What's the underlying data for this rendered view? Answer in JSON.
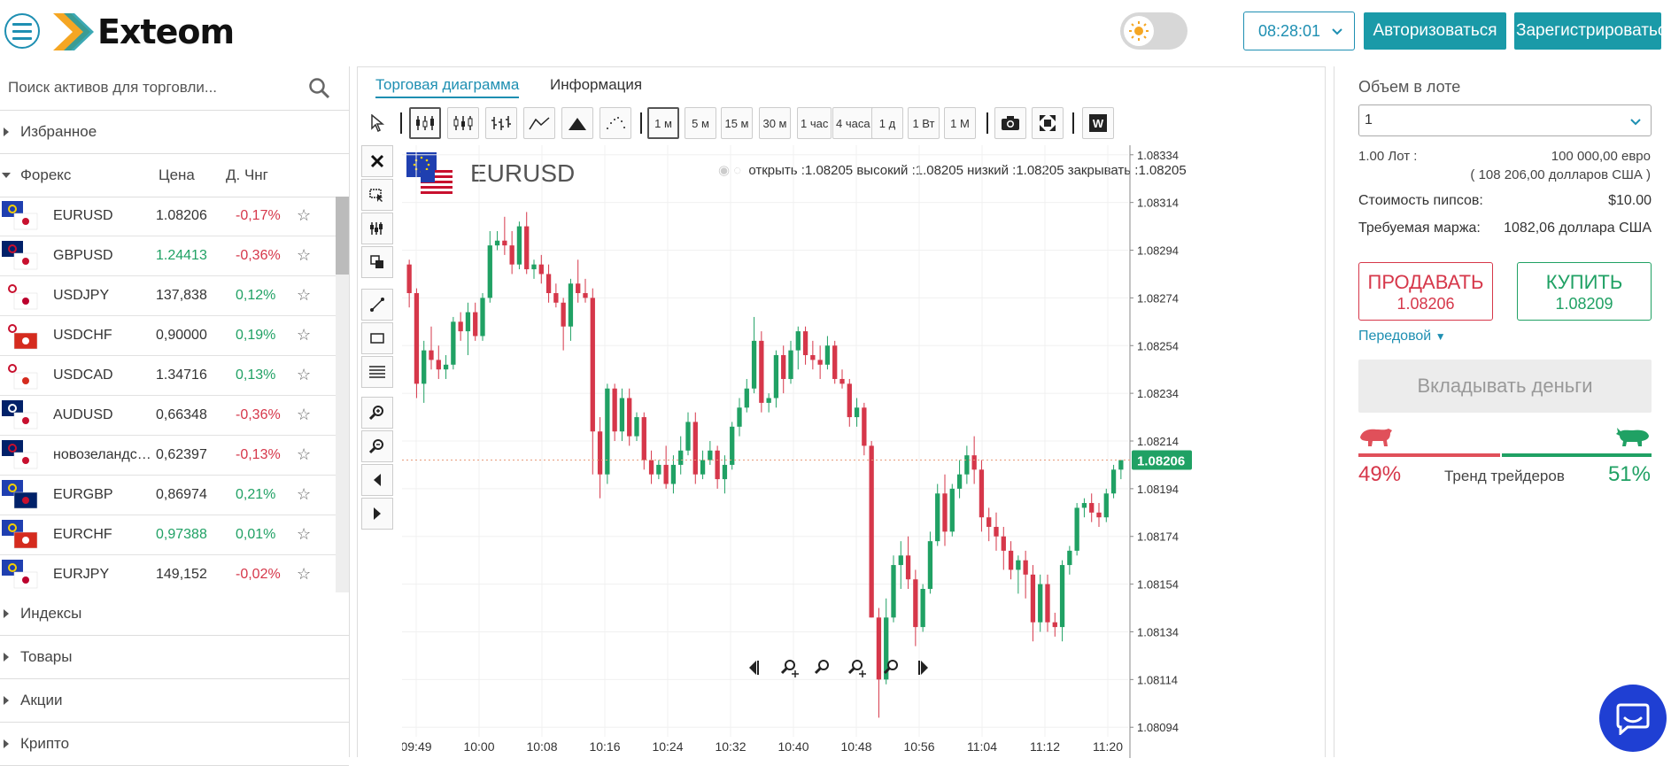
{
  "header": {
    "brand": "Exteom",
    "time": "08:28:01",
    "login_label": "Авторизоваться",
    "register_label": "Зарегистрироваться"
  },
  "sidebar": {
    "search_placeholder": "Поиск активов для торговли...",
    "favorites_label": "Избранное",
    "forex_label": "Форекс",
    "price_col": "Цена",
    "change_col": "Д. Чнг",
    "assets": [
      {
        "name": "EURUSD",
        "price": "1.08206",
        "change": "-0,17%",
        "price_dir": "neutral",
        "change_dir": "dn"
      },
      {
        "name": "GBPUSD",
        "price": "1.24413",
        "change": "-0,36%",
        "price_dir": "up",
        "change_dir": "dn"
      },
      {
        "name": "USDJPY",
        "price": "137,838",
        "change": "0,12%",
        "price_dir": "neutral",
        "change_dir": "up"
      },
      {
        "name": "USDCHF",
        "price": "0,90000",
        "change": "0,19%",
        "price_dir": "neutral",
        "change_dir": "up"
      },
      {
        "name": "USDCAD",
        "price": "1.34716",
        "change": "0,13%",
        "price_dir": "neutral",
        "change_dir": "up"
      },
      {
        "name": "AUDUSD",
        "price": "0,66348",
        "change": "-0,36%",
        "price_dir": "neutral",
        "change_dir": "dn"
      },
      {
        "name": "новозеландский доллар",
        "price": "0,62397",
        "change": "-0,13%",
        "price_dir": "neutral",
        "change_dir": "dn"
      },
      {
        "name": "EURGBP",
        "price": "0,86974",
        "change": "0,21%",
        "price_dir": "neutral",
        "change_dir": "up"
      },
      {
        "name": "EURCHF",
        "price": "0,97388",
        "change": "0,01%",
        "price_dir": "up",
        "change_dir": "up"
      },
      {
        "name": "EURJPY",
        "price": "149,152",
        "change": "-0,02%",
        "price_dir": "neutral",
        "change_dir": "dn"
      }
    ],
    "categories_below": [
      "Индексы",
      "Товары",
      "Акции",
      "Крипто"
    ]
  },
  "chart_panel": {
    "tabs": [
      "Торговая диаграмма",
      "Информация"
    ],
    "timeframes": [
      "1 м",
      "5 м",
      "15 м",
      "30 м",
      "1 час",
      "4 часа",
      "1 д",
      "1 Вт",
      "1 М"
    ],
    "symbol": "EURUSD",
    "ohlc_text": "открыть :1.08205 высокий :1.08205 низкий :1.08205 закрывать :1.08205",
    "current_price": "1.08206"
  },
  "chart_data": {
    "type": "candlestick",
    "y_ticks": [
      "1.08334",
      "1.08314",
      "1.08294",
      "1.08274",
      "1.08254",
      "1.08234",
      "1.08214",
      "1.08194",
      "1.08174",
      "1.08154",
      "1.08134",
      "1.08114",
      "1.08094"
    ],
    "x_ticks": [
      "09:49",
      "10:00",
      "10:08",
      "10:16",
      "10:24",
      "10:32",
      "10:40",
      "10:48",
      "10:56",
      "11:04",
      "11:12",
      "11:20"
    ],
    "ylim": [
      1.0809,
      1.08338
    ],
    "current_price": 1.08206,
    "candles": [
      [
        1.08288,
        1.0829,
        1.0827,
        1.08276
      ],
      [
        1.08276,
        1.08278,
        1.08232,
        1.08238
      ],
      [
        1.08238,
        1.08256,
        1.0823,
        1.08252
      ],
      [
        1.08252,
        1.08262,
        1.08244,
        1.08248
      ],
      [
        1.08248,
        1.08254,
        1.0824,
        1.08244
      ],
      [
        1.08244,
        1.0825,
        1.0824,
        1.08246
      ],
      [
        1.08246,
        1.08266,
        1.08244,
        1.08264
      ],
      [
        1.08264,
        1.08268,
        1.08256,
        1.0826
      ],
      [
        1.0826,
        1.08272,
        1.0825,
        1.08268
      ],
      [
        1.08268,
        1.08272,
        1.08256,
        1.08258
      ],
      [
        1.08258,
        1.08276,
        1.08256,
        1.08274
      ],
      [
        1.08274,
        1.08302,
        1.08272,
        1.08296
      ],
      [
        1.08296,
        1.08302,
        1.08294,
        1.08298
      ],
      [
        1.08298,
        1.08308,
        1.08292,
        1.08296
      ],
      [
        1.08296,
        1.08302,
        1.08284,
        1.08288
      ],
      [
        1.08288,
        1.08306,
        1.08286,
        1.08304
      ],
      [
        1.08304,
        1.0831,
        1.08284,
        1.08286
      ],
      [
        1.08286,
        1.0829,
        1.08282,
        1.08288
      ],
      [
        1.08288,
        1.08292,
        1.0828,
        1.08284
      ],
      [
        1.08284,
        1.08288,
        1.08272,
        1.08276
      ],
      [
        1.08276,
        1.0828,
        1.0827,
        1.08272
      ],
      [
        1.08272,
        1.08274,
        1.08252,
        1.08262
      ],
      [
        1.08262,
        1.08282,
        1.08256,
        1.0828
      ],
      [
        1.0828,
        1.0829,
        1.08272,
        1.08276
      ],
      [
        1.08276,
        1.08282,
        1.08272,
        1.08274
      ],
      [
        1.08274,
        1.08278,
        1.082,
        1.08218
      ],
      [
        1.08218,
        1.08224,
        1.0819,
        1.082
      ],
      [
        1.082,
        1.08238,
        1.08196,
        1.08236
      ],
      [
        1.08236,
        1.08238,
        1.08214,
        1.08218
      ],
      [
        1.08218,
        1.08236,
        1.08214,
        1.08232
      ],
      [
        1.08232,
        1.08236,
        1.08212,
        1.08216
      ],
      [
        1.08216,
        1.08226,
        1.08214,
        1.08224
      ],
      [
        1.08224,
        1.08226,
        1.08202,
        1.08206
      ],
      [
        1.08206,
        1.0821,
        1.08196,
        1.082
      ],
      [
        1.082,
        1.08206,
        1.08198,
        1.08204
      ],
      [
        1.08204,
        1.08212,
        1.08194,
        1.08196
      ],
      [
        1.08196,
        1.08208,
        1.08192,
        1.08204
      ],
      [
        1.08204,
        1.08216,
        1.082,
        1.0821
      ],
      [
        1.0821,
        1.08226,
        1.08208,
        1.08222
      ],
      [
        1.08222,
        1.08226,
        1.08196,
        1.082
      ],
      [
        1.082,
        1.0821,
        1.08198,
        1.08206
      ],
      [
        1.08206,
        1.08214,
        1.08204,
        1.0821
      ],
      [
        1.0821,
        1.08212,
        1.08194,
        1.08198
      ],
      [
        1.08198,
        1.08208,
        1.08192,
        1.08204
      ],
      [
        1.08204,
        1.08222,
        1.08202,
        1.0822
      ],
      [
        1.0822,
        1.08232,
        1.08216,
        1.08228
      ],
      [
        1.08228,
        1.0824,
        1.08226,
        1.08236
      ],
      [
        1.08236,
        1.08266,
        1.08234,
        1.08256
      ],
      [
        1.08256,
        1.0826,
        1.08226,
        1.0823
      ],
      [
        1.0823,
        1.08234,
        1.08226,
        1.08232
      ],
      [
        1.08232,
        1.08252,
        1.08228,
        1.0825
      ],
      [
        1.0825,
        1.08254,
        1.08234,
        1.0824
      ],
      [
        1.0824,
        1.08256,
        1.08238,
        1.08252
      ],
      [
        1.08252,
        1.08262,
        1.08244,
        1.0826
      ],
      [
        1.0826,
        1.08262,
        1.08246,
        1.0825
      ],
      [
        1.0825,
        1.08256,
        1.08244,
        1.08248
      ],
      [
        1.08248,
        1.08254,
        1.0824,
        1.08246
      ],
      [
        1.08246,
        1.08258,
        1.08244,
        1.08254
      ],
      [
        1.08254,
        1.08256,
        1.08238,
        1.0824
      ],
      [
        1.0824,
        1.08244,
        1.08236,
        1.08238
      ],
      [
        1.08238,
        1.0824,
        1.0822,
        1.08224
      ],
      [
        1.08224,
        1.08232,
        1.0822,
        1.08228
      ],
      [
        1.08228,
        1.0823,
        1.08208,
        1.08212
      ],
      [
        1.08212,
        1.08214,
        1.0814,
        1.0814
      ],
      [
        1.0814,
        1.08144,
        1.08098,
        1.08114
      ],
      [
        1.08114,
        1.08148,
        1.08112,
        1.0814
      ],
      [
        1.0814,
        1.08166,
        1.08138,
        1.08162
      ],
      [
        1.08162,
        1.08172,
        1.08152,
        1.08166
      ],
      [
        1.08166,
        1.08174,
        1.08152,
        1.08156
      ],
      [
        1.08156,
        1.0816,
        1.08128,
        1.08136
      ],
      [
        1.08136,
        1.08154,
        1.08134,
        1.08152
      ],
      [
        1.08152,
        1.08176,
        1.0815,
        1.08172
      ],
      [
        1.08172,
        1.08196,
        1.0817,
        1.08192
      ],
      [
        1.08192,
        1.082,
        1.0817,
        1.08176
      ],
      [
        1.08176,
        1.08196,
        1.08174,
        1.08194
      ],
      [
        1.08194,
        1.08206,
        1.0819,
        1.082
      ],
      [
        1.082,
        1.08212,
        1.08196,
        1.08208
      ],
      [
        1.08208,
        1.08216,
        1.08196,
        1.08202
      ],
      [
        1.08202,
        1.08206,
        1.08176,
        1.08182
      ],
      [
        1.08182,
        1.08186,
        1.08172,
        1.08178
      ],
      [
        1.08178,
        1.08184,
        1.08168,
        1.08174
      ],
      [
        1.08174,
        1.08178,
        1.0816,
        1.08168
      ],
      [
        1.08168,
        1.08172,
        1.08156,
        1.0816
      ],
      [
        1.0816,
        1.08166,
        1.0815,
        1.08164
      ],
      [
        1.08164,
        1.08168,
        1.08148,
        1.08158
      ],
      [
        1.08158,
        1.08162,
        1.0813,
        1.08138
      ],
      [
        1.08138,
        1.08158,
        1.08134,
        1.08154
      ],
      [
        1.08154,
        1.08158,
        1.08134,
        1.08138
      ],
      [
        1.08138,
        1.08142,
        1.08132,
        1.08136
      ],
      [
        1.08136,
        1.08164,
        1.0813,
        1.08162
      ],
      [
        1.08162,
        1.0817,
        1.08158,
        1.08168
      ],
      [
        1.08168,
        1.08188,
        1.08166,
        1.08186
      ],
      [
        1.08186,
        1.0819,
        1.08182,
        1.08188
      ],
      [
        1.08188,
        1.08192,
        1.0818,
        1.08184
      ],
      [
        1.08184,
        1.08188,
        1.08178,
        1.08182
      ],
      [
        1.08182,
        1.08194,
        1.0818,
        1.08192
      ],
      [
        1.08192,
        1.08204,
        1.0819,
        1.08202
      ],
      [
        1.08202,
        1.08206,
        1.08198,
        1.08206
      ]
    ]
  },
  "right_panel": {
    "lot_label": "Объем в лоте",
    "lot_value": "1",
    "lot_text": "1.00  Лот :",
    "lot_amount": "100 000,00 евро",
    "lot_usd": "( 108 206,00 долларов США )",
    "pip_label": "Стоимость пипсов:",
    "pip_value": "$10.00",
    "margin_label": "Требуемая маржа:",
    "margin_value": "1082,06 доллара США",
    "sell_label": "ПРОДАВАТЬ",
    "sell_price": "1.08206",
    "buy_label": "КУПИТЬ",
    "buy_price": "1.08209",
    "forward_label": "Передовой",
    "invest_label": "Вкладывать деньги",
    "trend_label": "Тренд трейдеров",
    "sell_pct": "49%",
    "buy_pct": "51%",
    "sell_share": 0.49,
    "buy_share": 0.51
  },
  "colors": {
    "accent": "#1e8fb2",
    "teal_button": "#1a9aa8",
    "up": "#20a164",
    "down": "#d6374a",
    "chat": "#1f3fd3"
  }
}
